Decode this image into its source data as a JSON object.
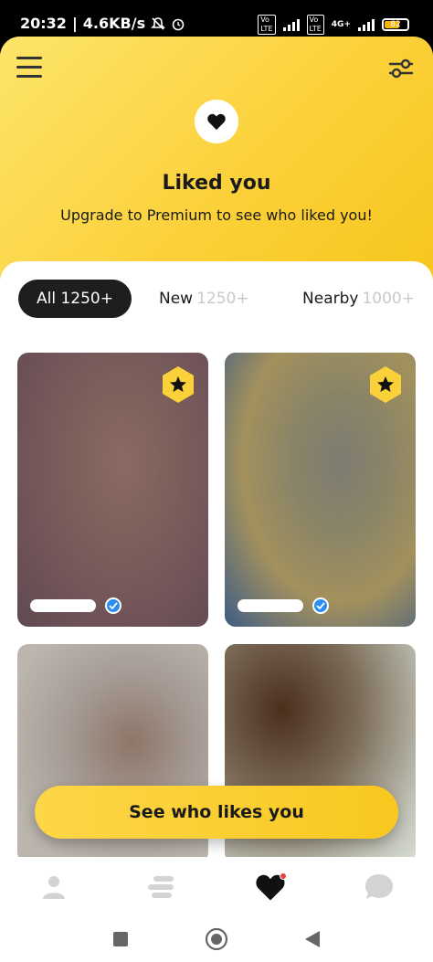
{
  "status_bar": {
    "time": "20:32",
    "speed": "4.6KB/s",
    "network_label": "4G+",
    "battery": "82"
  },
  "header": {
    "title": "Liked you",
    "subtitle": "Upgrade to Premium to see who liked you!"
  },
  "tabs": [
    {
      "label": "All",
      "count": "1250+"
    },
    {
      "label": "New",
      "count": "1250+"
    },
    {
      "label": "Nearby",
      "count": "1000+"
    }
  ],
  "cta": {
    "label": "See who likes you"
  },
  "colors": {
    "accent": "#FBD13A",
    "verified": "#2D8CF0",
    "notification_dot": "#E0463E"
  },
  "icons": {
    "menu": "hamburger-icon",
    "filter": "filter-sliders-icon",
    "header": "heart-icon",
    "badge": "star-hexagon-icon",
    "verified": "checkmark-icon",
    "nav": [
      "profile-icon",
      "people-icon",
      "heart-icon",
      "chat-bubble-icon"
    ]
  }
}
